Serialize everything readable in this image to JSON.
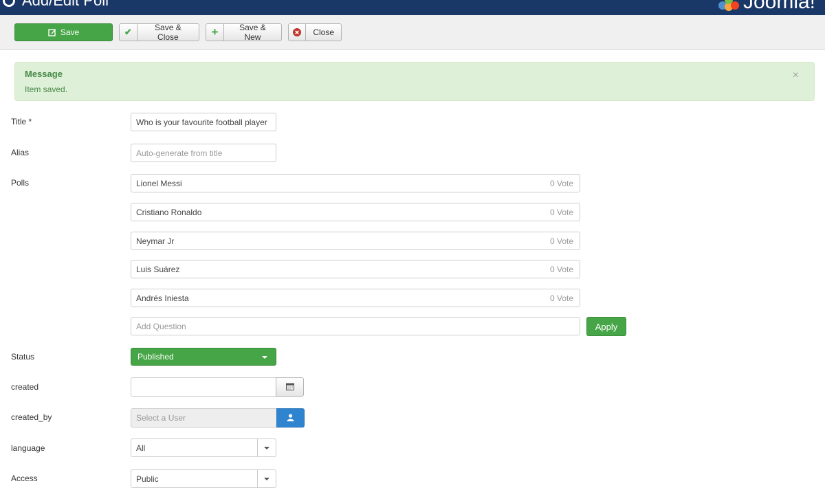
{
  "header": {
    "title": "Add/Edit Poll",
    "logo_text": "Joomla!"
  },
  "toolbar": {
    "save": "Save",
    "save_close": "Save & Close",
    "save_new": "Save & New",
    "close": "Close"
  },
  "message": {
    "heading": "Message",
    "text": "Item saved.",
    "dismiss": "×"
  },
  "form": {
    "title_label": "Title *",
    "title_value": "Who is your favourite football player",
    "alias_label": "Alias",
    "alias_placeholder": "Auto-generate from title",
    "polls_label": "Polls",
    "polls": [
      {
        "name": "Lionel Messi",
        "votes": "0 Vote"
      },
      {
        "name": "Cristiano Ronaldo",
        "votes": "0 Vote"
      },
      {
        "name": "Neymar Jr",
        "votes": "0 Vote"
      },
      {
        "name": "Luis Suárez",
        "votes": "0 Vote"
      },
      {
        "name": "Andrés Iniesta",
        "votes": "0 Vote"
      }
    ],
    "add_question_placeholder": "Add Question",
    "apply": "Apply",
    "status_label": "Status",
    "status_value": "Published",
    "created_label": "created",
    "created_value": "",
    "created_by_label": "created_by",
    "created_by_placeholder": "Select a User",
    "language_label": "language",
    "language_value": "All",
    "access_label": "Access",
    "access_value": "Public"
  },
  "colors": {
    "header_bg": "#1a3867",
    "success": "#46a546",
    "message_bg": "#dff0d8",
    "message_text": "#468847",
    "user_button": "#2f84d0"
  },
  "icons": {
    "title_icon": "circle-icon",
    "save_icon": "edit-icon",
    "save_close_icon": "checkmark-icon",
    "save_new_icon": "plus-icon",
    "close_icon": "cancel-circle-icon",
    "calendar_icon": "calendar-icon",
    "user_icon": "user-icon"
  }
}
